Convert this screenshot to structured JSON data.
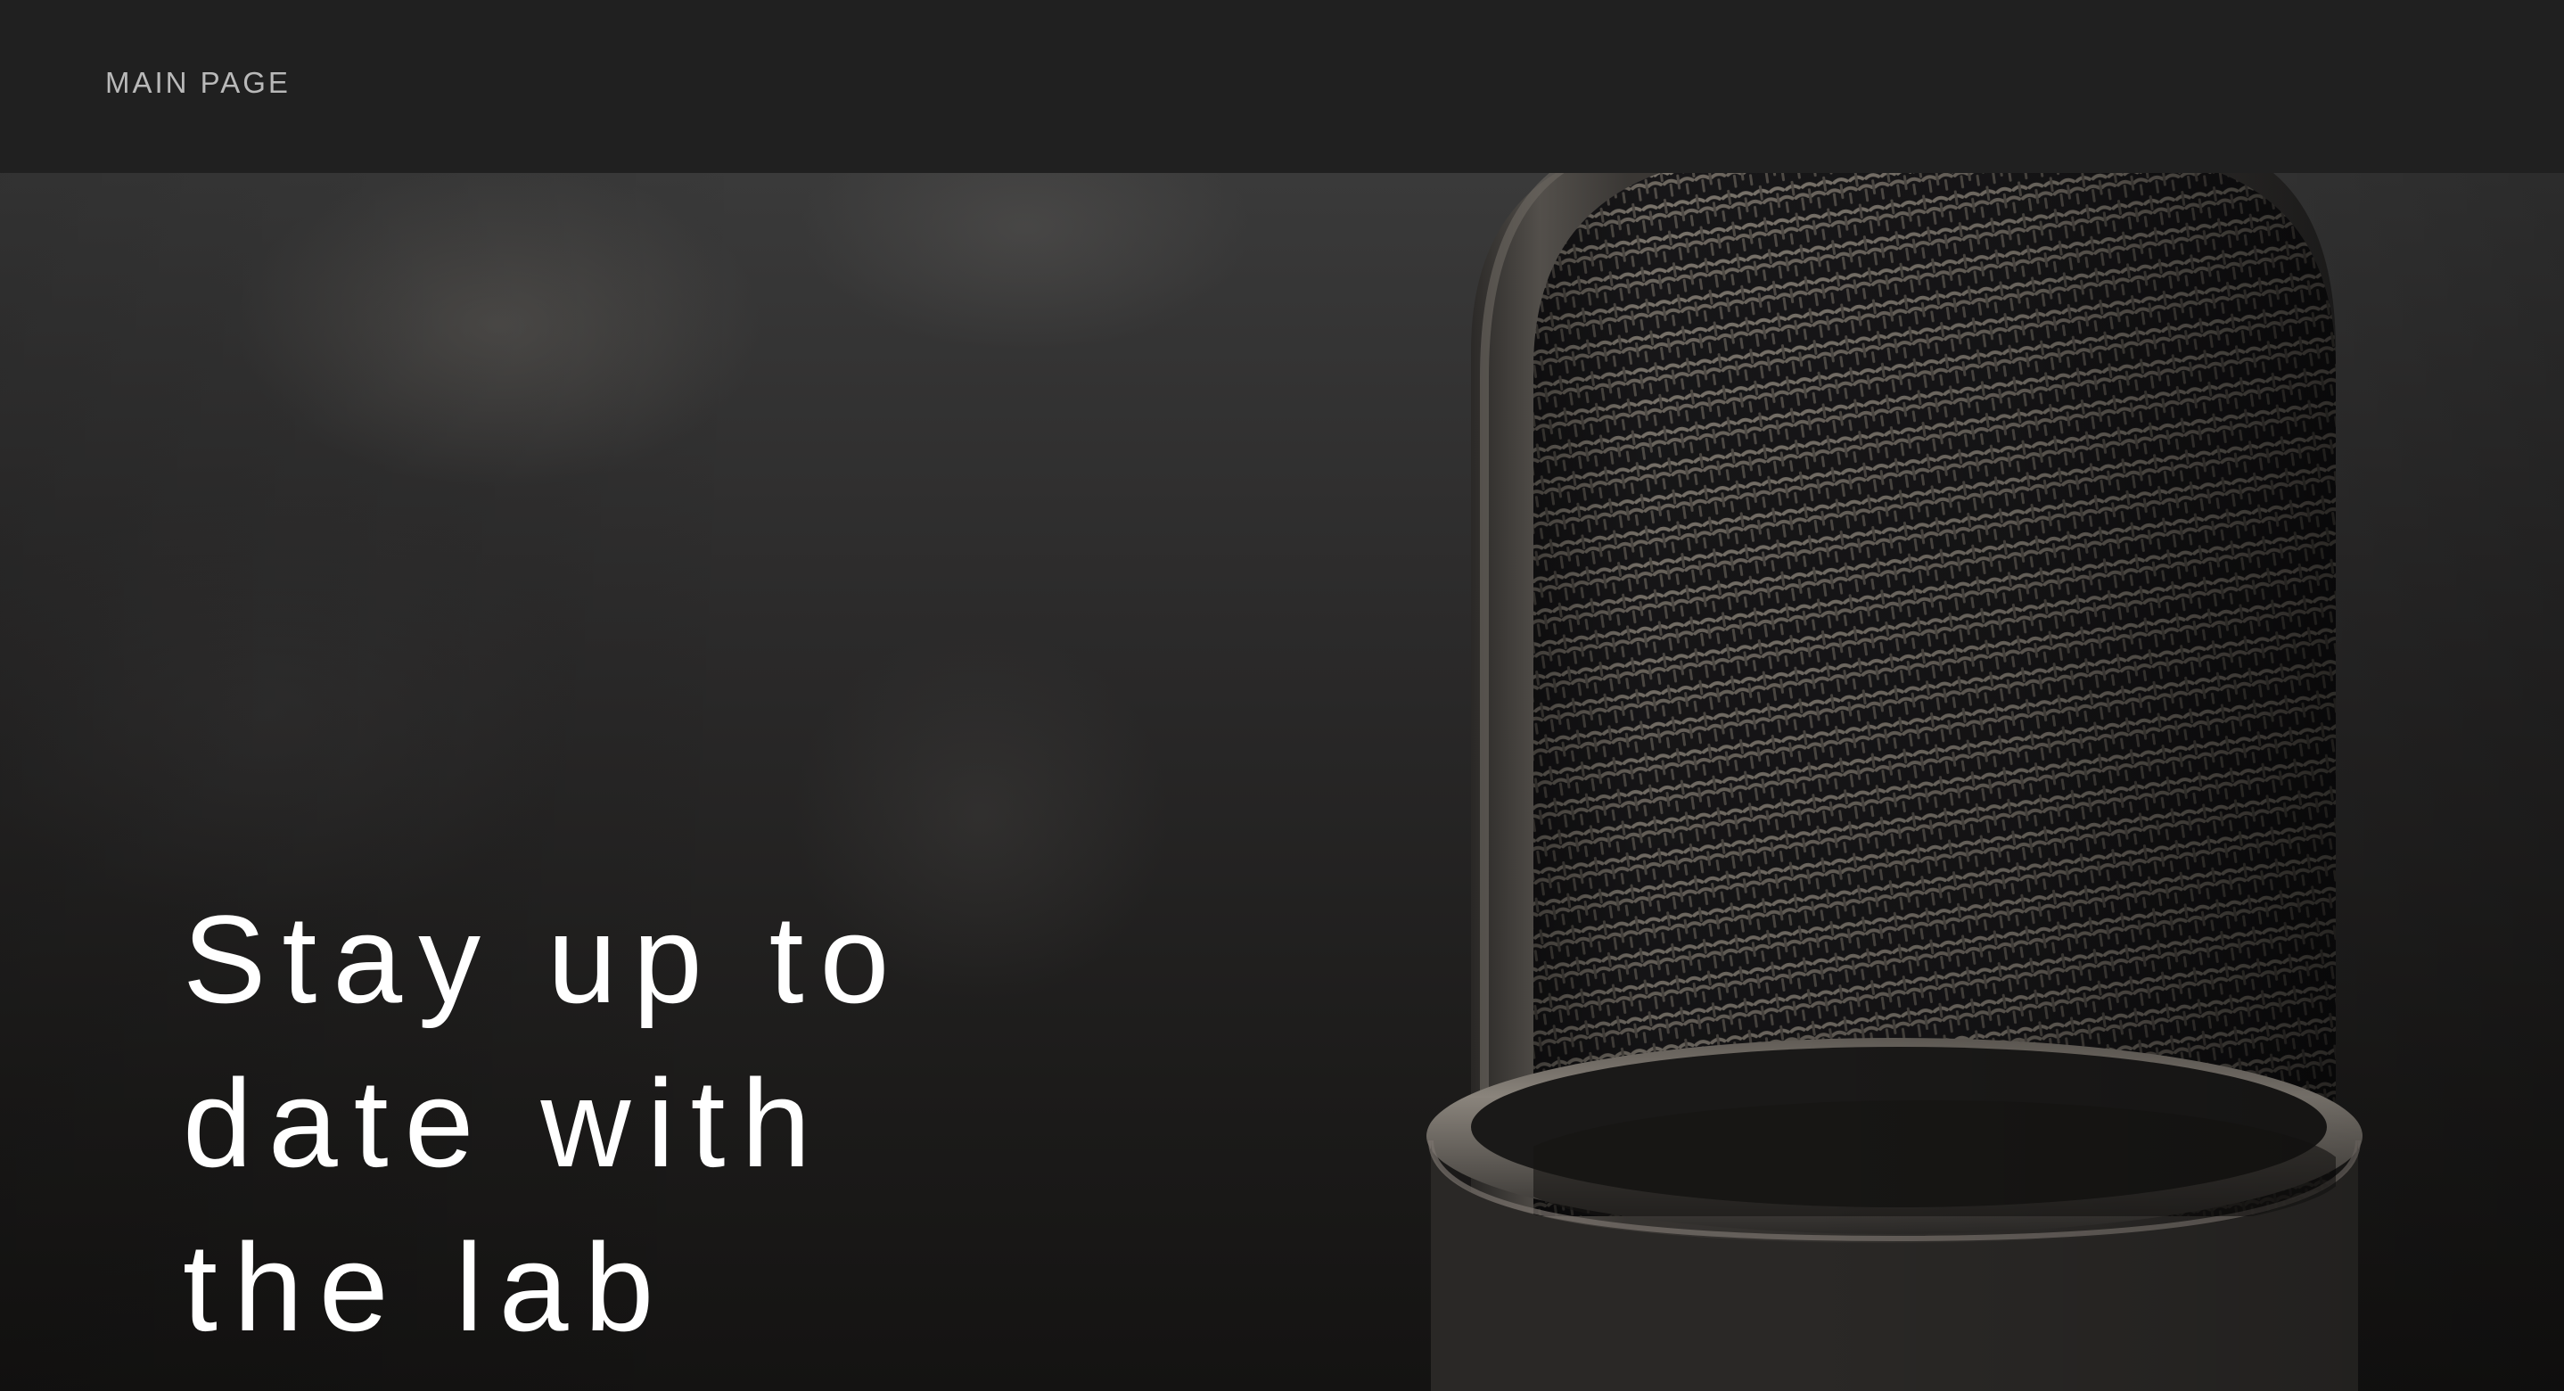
{
  "nav": {
    "main_page_label": "MAIN PAGE"
  },
  "hero": {
    "headline_lines": [
      "Stay up to",
      "date with",
      "the lab"
    ],
    "background_image": "microphone-photo"
  },
  "colors": {
    "topbar": "#202020",
    "nav_text": "#b9b9b9",
    "headline_text": "#ffffff"
  }
}
